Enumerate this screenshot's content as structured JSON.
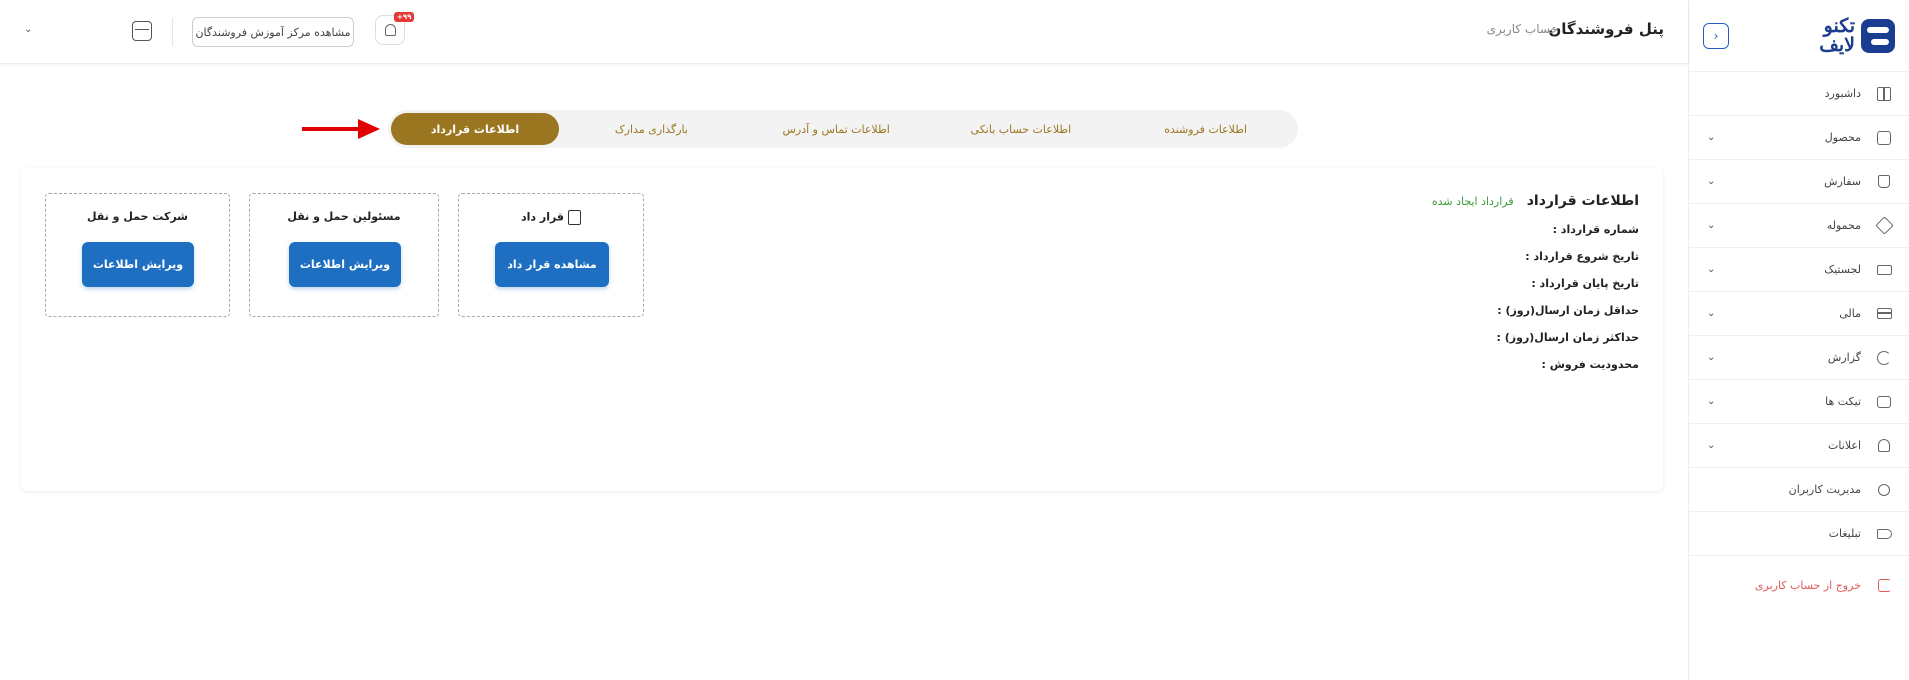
{
  "sidebar": {
    "logo_line1": "تکنو",
    "logo_line2": "لایف",
    "collapse_icon": "chevron-left-icon",
    "items": [
      {
        "label": "داشبورد",
        "icon": "dashboard-icon",
        "expandable": false
      },
      {
        "label": "محصول",
        "icon": "product-icon",
        "expandable": true
      },
      {
        "label": "سفارش",
        "icon": "order-bag-icon",
        "expandable": true
      },
      {
        "label": "محموله",
        "icon": "package-icon",
        "expandable": true
      },
      {
        "label": "لجستیک",
        "icon": "truck-icon",
        "expandable": true
      },
      {
        "label": "مالی",
        "icon": "wallet-icon",
        "expandable": true
      },
      {
        "label": "گزارش",
        "icon": "report-pie-icon",
        "expandable": true
      },
      {
        "label": "تیکت ها",
        "icon": "ticket-icon",
        "expandable": true
      },
      {
        "label": "اعلانات",
        "icon": "bell-icon",
        "expandable": true
      },
      {
        "label": "مدیریت کاربران",
        "icon": "user-edit-icon",
        "expandable": false
      },
      {
        "label": "تبلیغات",
        "icon": "megaphone-icon",
        "expandable": false
      }
    ],
    "logout_label": "خروج از حساب کاربری",
    "accent_color": "#1a3d8f"
  },
  "header": {
    "title": "پنل فروشندگان",
    "subtitle": "حساب کاربری",
    "notification_badge": "+۹۹",
    "academy_button": "مشاهده مرکز آموزش فروشندگان"
  },
  "tabs": {
    "items": [
      "اطلاعات فروشنده",
      "اطلاعات حساب بانکی",
      "اطلاعات تماس و آدرس",
      "بارگذاری مدارک",
      "اطلاعات قرارداد"
    ],
    "active_index": 4,
    "active_color": "#9a7620"
  },
  "contract": {
    "title": "اطلاعات قرارداد",
    "status": "قرارداد ایجاد شده",
    "fields": [
      "شماره قرارداد :",
      "تاریخ شروع قرارداد :",
      "تاریخ پایان قرارداد :",
      "حداقل زمان ارسال(روز) :",
      "حداکثر زمان ارسال(روز) :",
      "محدودیت فروش :"
    ]
  },
  "boxes": [
    {
      "title": "قرار داد",
      "button": "مشاهده قرار داد"
    },
    {
      "title": "مسئولین حمل و نقل",
      "button": "ویرایش اطلاعات"
    },
    {
      "title": "شرکت حمل و نقل",
      "button": "ویرایش اطلاعات"
    }
  ],
  "colors": {
    "primary_button": "#1e6fc1",
    "status_green": "#3a9a3a",
    "arrow_red": "#e00000"
  }
}
